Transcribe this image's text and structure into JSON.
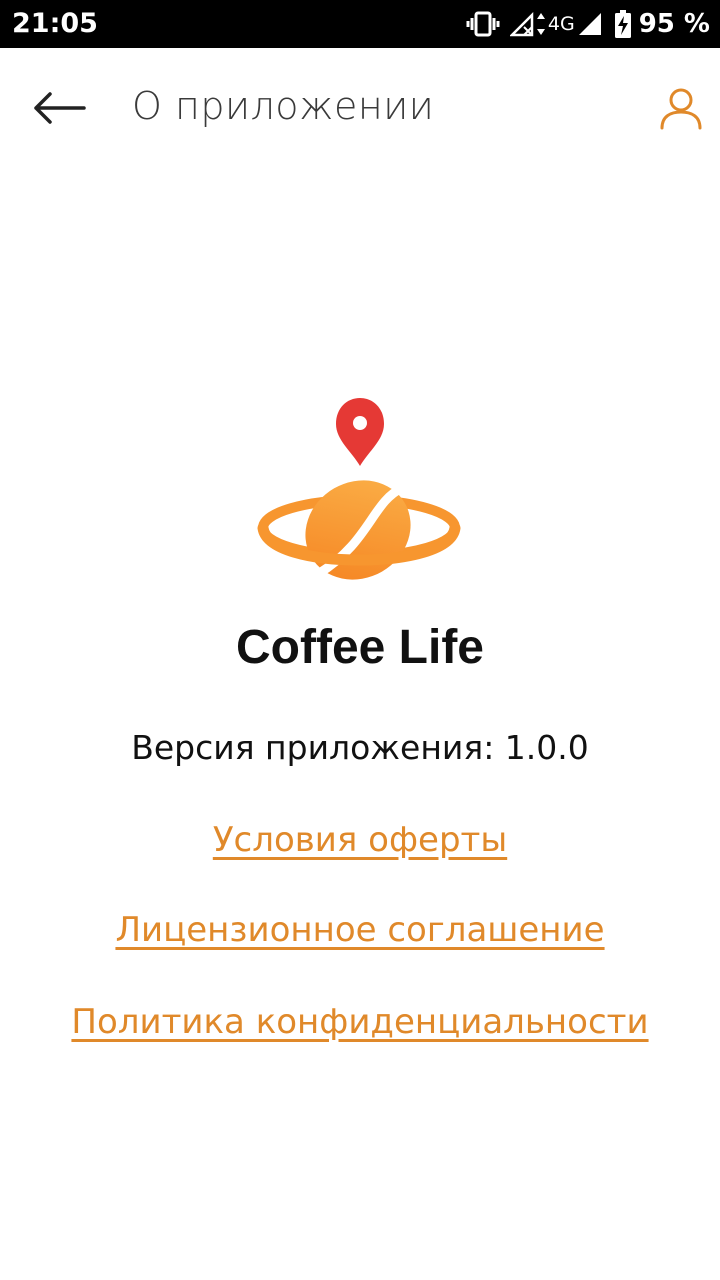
{
  "status_bar": {
    "time": "21:05",
    "network": "4G",
    "battery": "95 %",
    "icons": [
      "vibrate-icon",
      "signal-off-icon",
      "signal-icon",
      "battery-charging-icon"
    ]
  },
  "app_bar": {
    "title": "О приложении",
    "back_icon": "arrow-left-icon",
    "profile_icon": "user-icon"
  },
  "about": {
    "app_name": "Coffee Life",
    "version": "Версия приложения: 1.0.0",
    "links": [
      "Условия оферты",
      "Лицензионное соглашение",
      "Политика конфиденциальности"
    ]
  },
  "colors": {
    "accent": "#e0892a",
    "pin_red": "#e53935",
    "logo_orange": "#f7962f"
  }
}
